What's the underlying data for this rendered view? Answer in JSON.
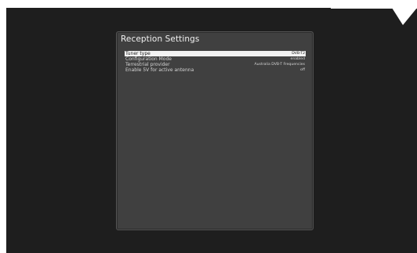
{
  "dialog": {
    "title": "Reception Settings"
  },
  "settings": [
    {
      "label": "Tuner type",
      "value": "DVB-T2",
      "selected": true
    },
    {
      "label": "Configuration Mode",
      "value": "enabled",
      "selected": false
    },
    {
      "label": "Terrestrial provider",
      "value": "Australia DVB-T Frequencies",
      "selected": false
    },
    {
      "label": "Enable 5V for active antenna",
      "value": "off",
      "selected": false
    }
  ],
  "colors": {
    "screen_bg": "#1e1e1e",
    "panel_bg": "#404040",
    "highlight": "#f2f2f2"
  }
}
